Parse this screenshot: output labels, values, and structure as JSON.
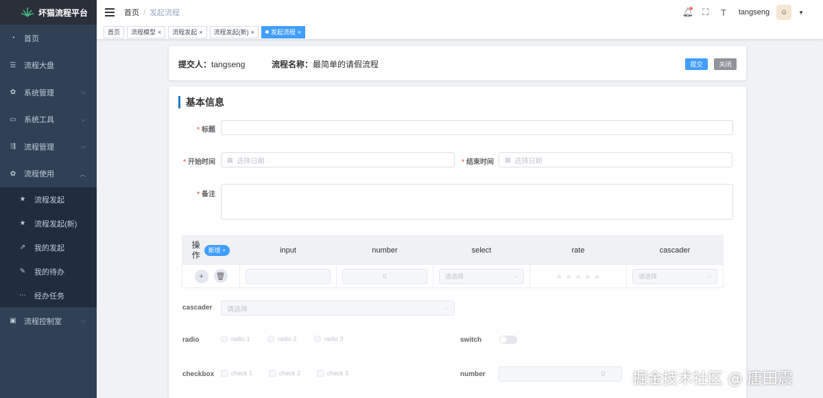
{
  "app": {
    "title": "坏猫流程平台"
  },
  "sidebar": {
    "items": [
      {
        "label": "首页",
        "icon": "dashboard-icon"
      },
      {
        "label": "流程大盘",
        "icon": "list-icon"
      },
      {
        "label": "系统管理",
        "icon": "gear-icon",
        "expandable": true
      },
      {
        "label": "系统工具",
        "icon": "toolbox-icon",
        "expandable": true
      },
      {
        "label": "流程管理",
        "icon": "flow-icon",
        "expandable": true
      },
      {
        "label": "流程使用",
        "icon": "gear-icon",
        "expanded": true,
        "children": [
          {
            "label": "流程发起",
            "icon": "star-icon"
          },
          {
            "label": "流程发起(新)",
            "icon": "star-icon"
          },
          {
            "label": "我的发起",
            "icon": "external-link-icon"
          },
          {
            "label": "我的待办",
            "icon": "edit-doc-icon"
          },
          {
            "label": "经办任务",
            "icon": "task-icon"
          }
        ]
      },
      {
        "label": "流程控制室",
        "icon": "monitor-icon",
        "expandable": true
      }
    ]
  },
  "navbar": {
    "breadcrumb": [
      "首页",
      "发起流程"
    ],
    "username": "tangseng"
  },
  "tags": [
    {
      "label": "首页",
      "closable": false,
      "active": false
    },
    {
      "label": "流程模型",
      "closable": true,
      "active": false
    },
    {
      "label": "流程发起",
      "closable": true,
      "active": false
    },
    {
      "label": "流程发起(新)",
      "closable": true,
      "active": false
    },
    {
      "label": "发起流程",
      "closable": true,
      "active": true
    }
  ],
  "header": {
    "submitter_label": "提交人：",
    "submitter": "tangseng",
    "flow_label": "流程名称：",
    "flow_name": "最简单的请假流程",
    "submit": "提交",
    "close": "关闭",
    "colors": {
      "primary": "#409eff",
      "gray": "#909399"
    }
  },
  "form": {
    "section_title": "基本信息",
    "title_label": "标题",
    "start_label": "开始时间",
    "start_placeholder": "选择日期",
    "end_label": "结束时间",
    "end_placeholder": "选择日期",
    "remark_label": "备注",
    "table": {
      "op_label": "操作",
      "add_button": "新增 +",
      "columns": [
        "input",
        "number",
        "select",
        "rate",
        "cascader"
      ],
      "row": {
        "number": "0",
        "select_placeholder": "请选择",
        "cascader_placeholder": "请选择"
      }
    },
    "cascader_label": "cascader",
    "cascader_placeholder": "请选择",
    "radio_label": "radio",
    "radios": [
      "radio 1",
      "radio 2",
      "radio 3"
    ],
    "switch_label": "switch",
    "checkbox_label": "checkbox",
    "checkboxes": [
      "check 1",
      "check 2",
      "check 3"
    ],
    "number_label": "number",
    "number_value": "0"
  },
  "watermark": "掘金技术社区 @ 唐田震"
}
